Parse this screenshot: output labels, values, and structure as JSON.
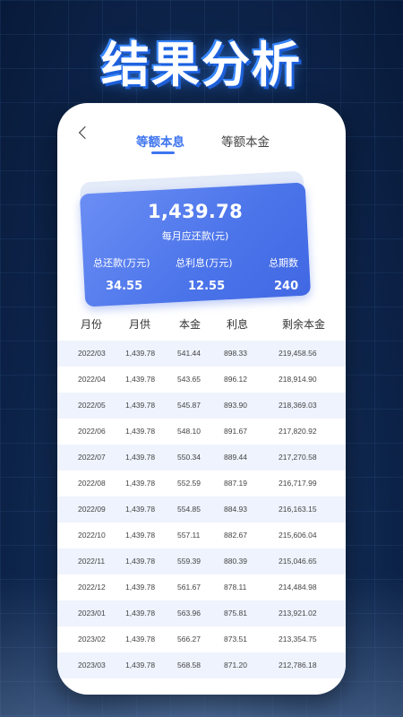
{
  "headline": "结果分析",
  "tabs": [
    {
      "label": "等额本息",
      "active": true
    },
    {
      "label": "等额本金",
      "active": false
    }
  ],
  "summary": {
    "monthly_payment": "1,439.78",
    "monthly_payment_label": "每月应还款(元)",
    "stats": [
      {
        "label": "总还款(万元)",
        "value": "34.55"
      },
      {
        "label": "总利息(万元)",
        "value": "12.55"
      },
      {
        "label": "总期数",
        "value": "240"
      }
    ]
  },
  "table": {
    "columns": [
      "月份",
      "月供",
      "本金",
      "利息",
      "剩余本金"
    ],
    "rows": [
      [
        "2022/03",
        "1,439.78",
        "541.44",
        "898.33",
        "219,458.56"
      ],
      [
        "2022/04",
        "1,439.78",
        "543.65",
        "896.12",
        "218,914.90"
      ],
      [
        "2022/05",
        "1,439.78",
        "545.87",
        "893.90",
        "218,369.03"
      ],
      [
        "2022/06",
        "1,439.78",
        "548.10",
        "891.67",
        "217,820.92"
      ],
      [
        "2022/07",
        "1,439.78",
        "550.34",
        "889.44",
        "217,270.58"
      ],
      [
        "2022/08",
        "1,439.78",
        "552.59",
        "887.19",
        "216,717.99"
      ],
      [
        "2022/09",
        "1,439.78",
        "554.85",
        "884.93",
        "216,163.15"
      ],
      [
        "2022/10",
        "1,439.78",
        "557.11",
        "882.67",
        "215,606.04"
      ],
      [
        "2022/11",
        "1,439.78",
        "559.39",
        "880.39",
        "215,046.65"
      ],
      [
        "2022/12",
        "1,439.78",
        "561.67",
        "878.11",
        "214,484.98"
      ],
      [
        "2023/01",
        "1,439.78",
        "563.96",
        "875.81",
        "213,921.02"
      ],
      [
        "2023/02",
        "1,439.78",
        "566.27",
        "873.51",
        "213,354.75"
      ],
      [
        "2023/03",
        "1,439.78",
        "568.58",
        "871.20",
        "212,786.18"
      ]
    ]
  },
  "colors": {
    "accent": "#3d74f0",
    "card": "#4b74ea",
    "row_stripe": "#eef3fd"
  }
}
